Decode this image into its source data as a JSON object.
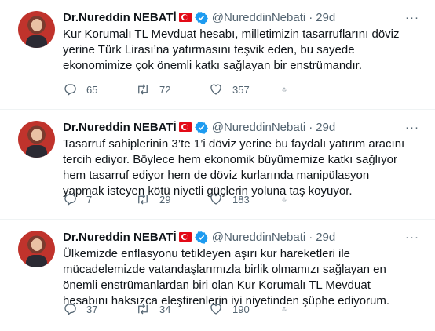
{
  "tweets": [
    {
      "name": "Dr.Nureddin NEBATİ",
      "handle": "@NureddinNebati",
      "separator": "·",
      "time": "29d",
      "more": "···",
      "text": "Kur Korumalı TL Mevduat hesabı, milletimizin tasarruflarını döviz yerine Türk Lirası’na yatırmasını teşvik eden, bu sayede ekonomimize çok önemli katkı sağlayan bir enstrümandır.",
      "replies": "65",
      "retweets": "72",
      "likes": "357"
    },
    {
      "name": "Dr.Nureddin NEBATİ",
      "handle": "@NureddinNebati",
      "separator": "·",
      "time": "29d",
      "more": "···",
      "text": "Tasarruf sahiplerinin 3’te 1’i döviz yerine bu faydalı yatırım aracını tercih ediyor. Böylece hem ekonomik büyümemize katkı sağlıyor hem tasarruf ediyor hem de döviz kurlarında manipülasyon yapmak isteyen kötü niyetli güçlerin yoluna taş koyuyor.",
      "replies": "7",
      "retweets": "29",
      "likes": "183"
    },
    {
      "name": "Dr.Nureddin NEBATİ",
      "handle": "@NureddinNebati",
      "separator": "·",
      "time": "29d",
      "more": "···",
      "text": "Ülkemizde enflasyonu tetikleyen aşırı kur hareketleri ile mücadelemizde vatandaşlarımızla birlik olmamızı sağlayan en önemli enstrümanlardan biri olan Kur Korumalı TL Mevduat hesabını haksızca eleştirenlerin iyi niyetinden şüphe ediyorum.",
      "replies": "37",
      "retweets": "34",
      "likes": "190"
    }
  ],
  "icons": {
    "verified": "verified-badge-icon",
    "flag": "turkey-flag-icon",
    "reply": "reply-icon",
    "retweet": "retweet-icon",
    "like": "heart-icon",
    "share": "share-icon"
  },
  "colors": {
    "text": "#0f1419",
    "secondary": "#536471",
    "verified": "#1d9bf0",
    "border": "#eff3f4"
  }
}
